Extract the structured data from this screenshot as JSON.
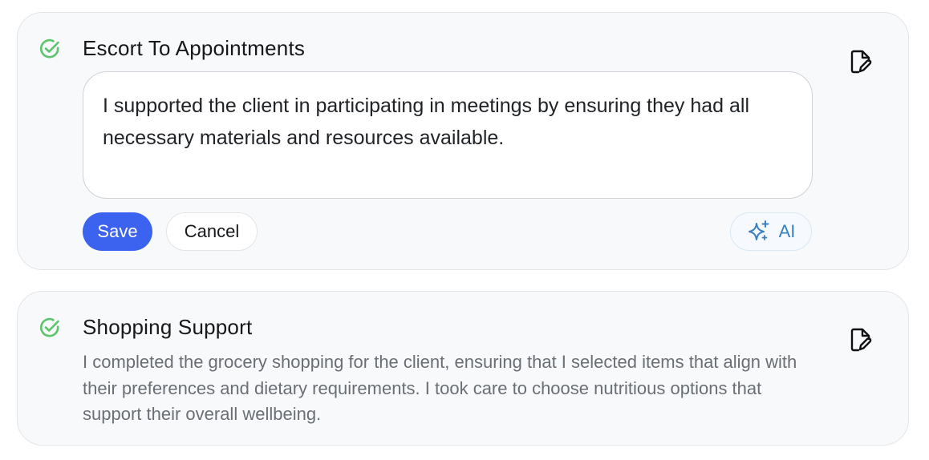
{
  "entries": [
    {
      "title": "Escort To Appointments",
      "note_value": "I supported the client in participating in meetings by ensuring they had all necessary materials and resources available.",
      "actions": {
        "save_label": "Save",
        "cancel_label": "Cancel",
        "ai_label": "AI"
      },
      "status_icon": "check-circle-icon",
      "action_icon": "document-edit-icon"
    },
    {
      "title": "Shopping Support",
      "note": "I completed the grocery shopping for the client, ensuring that I selected items that align with their preferences and dietary requirements. I took care to choose nutritious options that support their overall wellbeing.",
      "status_icon": "check-circle-icon",
      "action_icon": "document-edit-icon"
    }
  ],
  "colors": {
    "check_green": "#5cc46b",
    "primary_blue": "#3b63f0",
    "ai_blue": "#3a7fc1",
    "card_bg": "#f8f9fb"
  }
}
